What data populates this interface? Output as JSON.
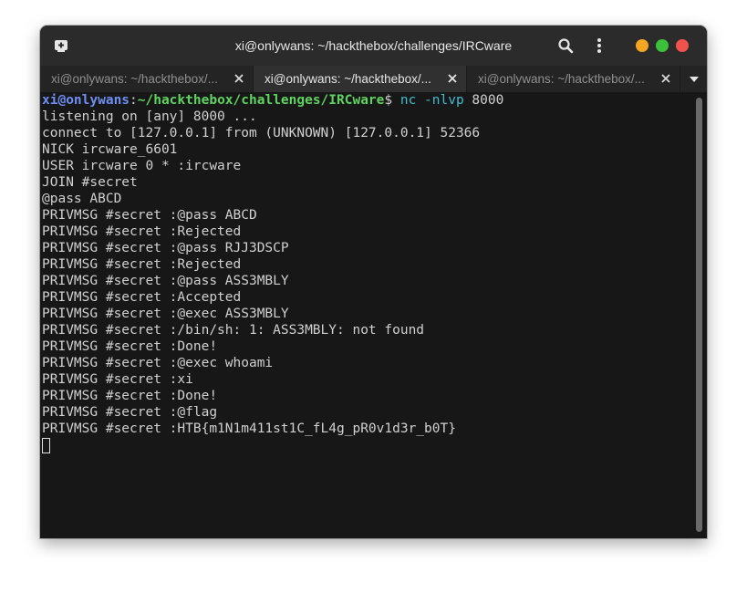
{
  "window": {
    "title": "xi@onlywans: ~/hackthebox/challenges/IRCware",
    "controls": {
      "minimize_color": "#f5a623",
      "maximize_color": "#3cc13b",
      "close_color": "#f0534d"
    }
  },
  "icons": {
    "new_tab": "new-tab-icon",
    "search": "search-icon",
    "menu": "kebab-menu-icon",
    "close_tab": "close-icon",
    "overflow": "chevron-down-icon"
  },
  "tabs": [
    {
      "label": "xi@onlywans: ~/hackthebox/...",
      "active": false
    },
    {
      "label": "xi@onlywans: ~/hackthebox/...",
      "active": true
    },
    {
      "label": "xi@onlywans: ~/hackthebox/...",
      "active": false
    }
  ],
  "terminal": {
    "prompt": {
      "user": "xi@onlywans",
      "separator": ":",
      "path": "~/hackthebox/challenges/IRCware",
      "sign": "$ ",
      "command": "nc -nlvp",
      "args": " 8000"
    },
    "output": [
      "listening on [any] 8000 ...",
      "connect to [127.0.0.1] from (UNKNOWN) [127.0.0.1] 52366",
      "NICK ircware_6601",
      "USER ircware 0 * :ircware",
      "JOIN #secret",
      "@pass ABCD",
      "PRIVMSG #secret :@pass ABCD",
      "PRIVMSG #secret :Rejected",
      "PRIVMSG #secret :@pass RJJ3DSCP",
      "PRIVMSG #secret :Rejected",
      "PRIVMSG #secret :@pass ASS3MBLY",
      "PRIVMSG #secret :Accepted",
      "PRIVMSG #secret :@exec ASS3MBLY",
      "PRIVMSG #secret :/bin/sh: 1: ASS3MBLY: not found",
      "PRIVMSG #secret :Done!",
      "PRIVMSG #secret :@exec whoami",
      "PRIVMSG #secret :xi",
      "PRIVMSG #secret :Done!",
      "PRIVMSG #secret :@flag",
      "PRIVMSG #secret :HTB{m1N1m411st1C_fL4g_pR0v1d3r_b0T}"
    ]
  }
}
